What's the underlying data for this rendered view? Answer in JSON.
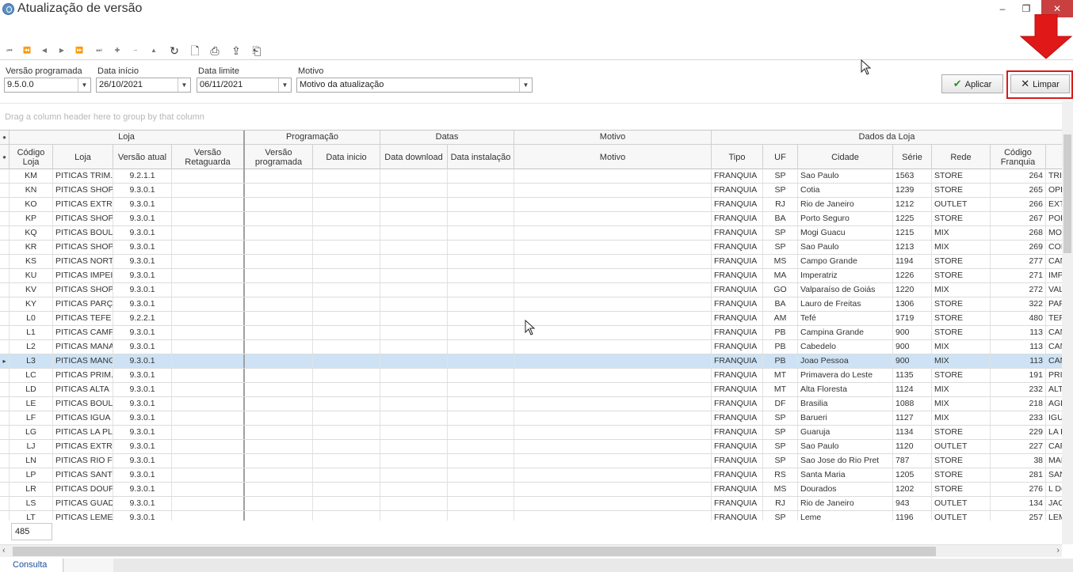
{
  "window": {
    "title": "Atualização de versão",
    "controls": [
      "–",
      "❐",
      "✕"
    ]
  },
  "toolbar": {
    "nav_glyphs": [
      "⏮",
      "⏪",
      "◀",
      "▶",
      "⏩",
      "⏭",
      "✚",
      "−",
      "▲",
      "✓"
    ],
    "refresh_glyph": "↻",
    "preview_glyph": "🗋",
    "print_glyph": "⎙",
    "export_glyph": "⇪",
    "exit_glyph": "⎗"
  },
  "filters": {
    "versao_programada": {
      "label": "Versão programada",
      "value": "9.5.0.0"
    },
    "data_inicio": {
      "label": "Data início",
      "value": "26/10/2021"
    },
    "data_limite": {
      "label": "Data limite",
      "value": "06/11/2021"
    },
    "motivo": {
      "label": "Motivo",
      "value": "Motivo da atualização"
    },
    "apply_label": "Aplicar",
    "clear_label": "Limpar"
  },
  "group_hint": "Drag a column header here to group by that column",
  "bands": {
    "loja": "Loja",
    "programacao": "Programação",
    "datas": "Datas",
    "motivo": "Motivo",
    "dados_loja": "Dados da Loja"
  },
  "columns": {
    "codigo_loja": "Código Loja",
    "loja": "Loja",
    "versao_atual": "Versão atual",
    "versao_retaguarda": "Versão Retaguarda",
    "versao_programada": "Versão programada",
    "data_inicio": "Data inicio",
    "data_download": "Data download",
    "data_instalacao": "Data instalação",
    "motivo": "Motivo",
    "tipo": "Tipo",
    "uf": "UF",
    "cidade": "Cidade",
    "serie": "Série",
    "rede": "Rede",
    "codigo_franquia": "Código Franquia"
  },
  "rows": [
    {
      "cod": "KM",
      "loja": "PITICAS TRIM.",
      "ver": "9.2.1.1",
      "tipo": "FRANQUIA",
      "uf": "SP",
      "cidade": "Sao Paulo",
      "serie": "1563",
      "rede": "STORE",
      "fran": "264",
      "extra": "TRI"
    },
    {
      "cod": "KN",
      "loja": "PITICAS SHOP",
      "ver": "9.3.0.1",
      "tipo": "FRANQUIA",
      "uf": "SP",
      "cidade": "Cotia",
      "serie": "1239",
      "rede": "STORE",
      "fran": "265",
      "extra": "OPE"
    },
    {
      "cod": "KO",
      "loja": "PITICAS EXTR.",
      "ver": "9.3.0.1",
      "tipo": "FRANQUIA",
      "uf": "RJ",
      "cidade": "Rio de Janeiro",
      "serie": "1212",
      "rede": "OUTLET",
      "fran": "266",
      "extra": "EXT"
    },
    {
      "cod": "KP",
      "loja": "PITICAS SHOP",
      "ver": "9.3.0.1",
      "tipo": "FRANQUIA",
      "uf": "BA",
      "cidade": "Porto Seguro",
      "serie": "1225",
      "rede": "STORE",
      "fran": "267",
      "extra": "POF"
    },
    {
      "cod": "KQ",
      "loja": "PITICAS BOUL",
      "ver": "9.3.0.1",
      "tipo": "FRANQUIA",
      "uf": "SP",
      "cidade": "Mogi Guacu",
      "serie": "1215",
      "rede": "MIX",
      "fran": "268",
      "extra": "MO"
    },
    {
      "cod": "KR",
      "loja": "PITICAS SHOP",
      "ver": "9.3.0.1",
      "tipo": "FRANQUIA",
      "uf": "SP",
      "cidade": "Sao Paulo",
      "serie": "1213",
      "rede": "MIX",
      "fran": "269",
      "extra": "COI"
    },
    {
      "cod": "KS",
      "loja": "PITICAS NORT",
      "ver": "9.3.0.1",
      "tipo": "FRANQUIA",
      "uf": "MS",
      "cidade": "Campo Grande",
      "serie": "1194",
      "rede": "STORE",
      "fran": "277",
      "extra": "CAN"
    },
    {
      "cod": "KU",
      "loja": "PITICAS IMPEI",
      "ver": "9.3.0.1",
      "tipo": "FRANQUIA",
      "uf": "MA",
      "cidade": "Imperatriz",
      "serie": "1226",
      "rede": "STORE",
      "fran": "271",
      "extra": "IMP"
    },
    {
      "cod": "KV",
      "loja": "PITICAS SHOP",
      "ver": "9.3.0.1",
      "tipo": "FRANQUIA",
      "uf": "GO",
      "cidade": "Valparaíso de Goiás",
      "serie": "1220",
      "rede": "MIX",
      "fran": "272",
      "extra": "VAL"
    },
    {
      "cod": "KY",
      "loja": "PITICAS PARÇ",
      "ver": "9.3.0.1",
      "tipo": "FRANQUIA",
      "uf": "BA",
      "cidade": "Lauro de Freitas",
      "serie": "1306",
      "rede": "STORE",
      "fran": "322",
      "extra": "PAF"
    },
    {
      "cod": "L0",
      "loja": "PITICAS TEFE",
      "ver": "9.2.2.1",
      "tipo": "FRANQUIA",
      "uf": "AM",
      "cidade": "Tefé",
      "serie": "1719",
      "rede": "STORE",
      "fran": "480",
      "extra": "TEF"
    },
    {
      "cod": "L1",
      "loja": "PITICAS CAMF",
      "ver": "9.3.0.1",
      "tipo": "FRANQUIA",
      "uf": "PB",
      "cidade": "Campina Grande",
      "serie": "900",
      "rede": "STORE",
      "fran": "113",
      "extra": "CAN"
    },
    {
      "cod": "L2",
      "loja": "PITICAS MANA",
      "ver": "9.3.0.1",
      "tipo": "FRANQUIA",
      "uf": "PB",
      "cidade": "Cabedelo",
      "serie": "900",
      "rede": "MIX",
      "fran": "113",
      "extra": "CAN"
    },
    {
      "cod": "L3",
      "loja": "PITICAS MANG",
      "ver": "9.3.0.1",
      "tipo": "FRANQUIA",
      "uf": "PB",
      "cidade": "Joao Pessoa",
      "serie": "900",
      "rede": "MIX",
      "fran": "113",
      "extra": "CAN",
      "selected": true
    },
    {
      "cod": "LC",
      "loja": "PITICAS PRIM.",
      "ver": "9.3.0.1",
      "tipo": "FRANQUIA",
      "uf": "MT",
      "cidade": "Primavera do Leste",
      "serie": "1135",
      "rede": "STORE",
      "fran": "191",
      "extra": "PRI"
    },
    {
      "cod": "LD",
      "loja": "PITICAS ALTA",
      "ver": "9.3.0.1",
      "tipo": "FRANQUIA",
      "uf": "MT",
      "cidade": "Alta Floresta",
      "serie": "1124",
      "rede": "MIX",
      "fran": "232",
      "extra": "ALT"
    },
    {
      "cod": "LE",
      "loja": "PITICAS BOUL",
      "ver": "9.3.0.1",
      "tipo": "FRANQUIA",
      "uf": "DF",
      "cidade": "Brasilia",
      "serie": "1088",
      "rede": "MIX",
      "fran": "218",
      "extra": "AGL"
    },
    {
      "cod": "LF",
      "loja": "PITICAS IGUA",
      "ver": "9.3.0.1",
      "tipo": "FRANQUIA",
      "uf": "SP",
      "cidade": "Barueri",
      "serie": "1127",
      "rede": "MIX",
      "fran": "233",
      "extra": "IGU"
    },
    {
      "cod": "LG",
      "loja": "PITICAS LA PL",
      "ver": "9.3.0.1",
      "tipo": "FRANQUIA",
      "uf": "SP",
      "cidade": "Guaruja",
      "serie": "1134",
      "rede": "STORE",
      "fran": "229",
      "extra": "LA F"
    },
    {
      "cod": "LJ",
      "loja": "PITICAS EXTR.",
      "ver": "9.3.0.1",
      "tipo": "FRANQUIA",
      "uf": "SP",
      "cidade": "Sao Paulo",
      "serie": "1120",
      "rede": "OUTLET",
      "fran": "227",
      "extra": "CAF"
    },
    {
      "cod": "LN",
      "loja": "PITICAS RIO F",
      "ver": "9.3.0.1",
      "tipo": "FRANQUIA",
      "uf": "SP",
      "cidade": "Sao Jose do Rio Pret",
      "serie": "787",
      "rede": "STORE",
      "fran": "38",
      "extra": "MAI"
    },
    {
      "cod": "LP",
      "loja": "PITICAS SANT",
      "ver": "9.3.0.1",
      "tipo": "FRANQUIA",
      "uf": "RS",
      "cidade": "Santa Maria",
      "serie": "1205",
      "rede": "STORE",
      "fran": "281",
      "extra": "SAN"
    },
    {
      "cod": "LR",
      "loja": "PITICAS DOUF",
      "ver": "9.3.0.1",
      "tipo": "FRANQUIA",
      "uf": "MS",
      "cidade": "Dourados",
      "serie": "1202",
      "rede": "STORE",
      "fran": "276",
      "extra": "L D("
    },
    {
      "cod": "LS",
      "loja": "PITICAS GUAD",
      "ver": "9.3.0.1",
      "tipo": "FRANQUIA",
      "uf": "RJ",
      "cidade": "Rio de Janeiro",
      "serie": "943",
      "rede": "OUTLET",
      "fran": "134",
      "extra": "JAC"
    },
    {
      "cod": "LT",
      "loja": "PITICAS LEME",
      "ver": "9.3.0.1",
      "tipo": "FRANQUIA",
      "uf": "SP",
      "cidade": "Leme",
      "serie": "1196",
      "rede": "OUTLET",
      "fran": "257",
      "extra": "LEM"
    }
  ],
  "record_count": "485",
  "tabs": {
    "active": "Consulta"
  },
  "colors": {
    "selected_row": "#cde3f5",
    "highlight_border": "#d91a1a",
    "arrow_red": "#e01818"
  }
}
